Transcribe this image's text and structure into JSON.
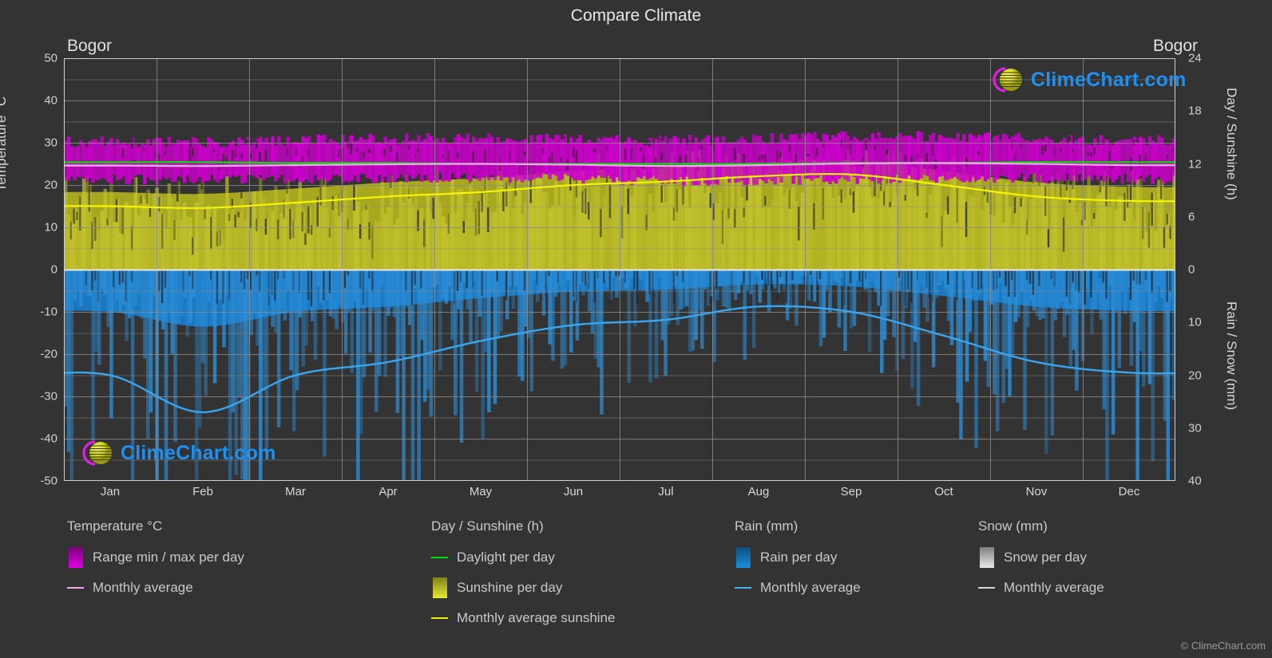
{
  "header": {
    "title": "Compare Climate",
    "location_left": "Bogor",
    "location_right": "Bogor"
  },
  "watermark": {
    "text": "ClimeChart.com",
    "copyright": "© ClimeChart.com"
  },
  "axes": {
    "left_label": "Temperature °C",
    "right_label_top": "Day / Sunshine (h)",
    "right_label_bottom": "Rain / Snow (mm)",
    "left_ticks": [
      "50",
      "40",
      "30",
      "20",
      "10",
      "0",
      "-10",
      "-20",
      "-30",
      "-40",
      "-50"
    ],
    "right_ticks_top": [
      "24",
      "18",
      "12",
      "6",
      "0"
    ],
    "right_ticks_bottom": [
      "10",
      "20",
      "30",
      "40"
    ],
    "x_ticks": [
      "Jan",
      "Feb",
      "Mar",
      "Apr",
      "May",
      "Jun",
      "Jul",
      "Aug",
      "Sep",
      "Oct",
      "Nov",
      "Dec"
    ]
  },
  "legend": {
    "groups": [
      {
        "title": "Temperature °C",
        "items": [
          {
            "label": "Range min / max per day",
            "marker": "box",
            "color": "#e000e0"
          },
          {
            "label": "Monthly average",
            "marker": "line",
            "color": "#f0a8e8"
          }
        ]
      },
      {
        "title": "Day / Sunshine (h)",
        "items": [
          {
            "label": "Daylight per day",
            "marker": "line",
            "color": "#00e000"
          },
          {
            "label": "Sunshine per day",
            "marker": "box",
            "color": "#e8e830"
          },
          {
            "label": "Monthly average sunshine",
            "marker": "line",
            "color": "#f0f000"
          }
        ]
      },
      {
        "title": "Rain (mm)",
        "items": [
          {
            "label": "Rain per day",
            "marker": "box",
            "color": "#1a8fe0"
          },
          {
            "label": "Monthly average",
            "marker": "line",
            "color": "#4ab0f0"
          }
        ]
      },
      {
        "title": "Snow (mm)",
        "items": [
          {
            "label": "Snow per day",
            "marker": "box",
            "color": "#e8e8e8"
          },
          {
            "label": "Monthly average",
            "marker": "line",
            "color": "#d8d8d8"
          }
        ]
      }
    ]
  },
  "colors": {
    "background": "#333333",
    "grid": "#8a8a8a",
    "axis": "#cfcfcf",
    "text": "#d8d8d8",
    "temp_range": "#cc00cc",
    "temp_avg": "#f0a8e8",
    "daylight": "#00e400",
    "sunshine_fill": "#a8a820",
    "sunshine_avg": "#f5f500",
    "rain_fill": "#1a78c0",
    "rain_avg": "#3aa5ef",
    "logo_blue": "#1f90f0",
    "logo_magenta": "#e020e0",
    "logo_yellow": "#d8d820"
  },
  "chart_data": {
    "type": "area",
    "title": "Compare Climate",
    "subtitle": "Bogor",
    "xlabel": "",
    "ylabel": "Temperature °C",
    "categories": [
      "Jan",
      "Feb",
      "Mar",
      "Apr",
      "May",
      "Jun",
      "Jul",
      "Aug",
      "Sep",
      "Oct",
      "Nov",
      "Dec"
    ],
    "axis_ranges": {
      "temperature_c": [
        -50,
        50
      ],
      "day_sunshine_h": [
        0,
        24
      ],
      "rain_snow_mm": [
        0,
        40
      ]
    },
    "grid": true,
    "legend_position": "bottom",
    "series": [
      {
        "name": "Monthly average temperature (°C)",
        "axis": "temperature_c",
        "color": "#f0a8e8",
        "values": [
          24.6,
          24.5,
          24.7,
          24.9,
          25.0,
          24.8,
          24.5,
          24.7,
          25.1,
          25.2,
          25.0,
          24.7
        ]
      },
      {
        "name": "Daily max temperature (°C)",
        "axis": "temperature_c",
        "color": "#cc00cc",
        "values": [
          30.1,
          30.0,
          30.5,
          30.8,
          31.0,
          30.7,
          30.5,
          30.9,
          31.4,
          31.3,
          30.9,
          30.4
        ]
      },
      {
        "name": "Daily min temperature (°C)",
        "axis": "temperature_c",
        "color": "#cc00cc",
        "values": [
          21.5,
          21.4,
          21.6,
          21.8,
          21.9,
          21.5,
          21.0,
          21.1,
          21.4,
          21.7,
          21.8,
          21.6
        ]
      },
      {
        "name": "Daylight per day (h)",
        "axis": "day_sunshine_h",
        "color": "#00e400",
        "values": [
          12.2,
          12.2,
          12.1,
          12.1,
          12.0,
          12.0,
          12.0,
          12.0,
          12.1,
          12.1,
          12.2,
          12.2
        ]
      },
      {
        "name": "Monthly average sunshine (h)",
        "axis": "day_sunshine_h",
        "color": "#f5f500",
        "values": [
          7.2,
          7.0,
          7.6,
          8.3,
          8.8,
          9.6,
          10.0,
          10.6,
          10.8,
          9.6,
          8.3,
          7.8
        ]
      },
      {
        "name": "Monthly average rain (mm)",
        "axis": "rain_snow_mm",
        "color": "#3aa5ef",
        "values": [
          20.0,
          27.0,
          20.0,
          17.5,
          13.5,
          10.5,
          9.5,
          7.0,
          8.0,
          12.5,
          17.5,
          19.5
        ]
      },
      {
        "name": "Monthly average snow (mm)",
        "axis": "rain_snow_mm",
        "color": "#d8d8d8",
        "values": [
          0,
          0,
          0,
          0,
          0,
          0,
          0,
          0,
          0,
          0,
          0,
          0
        ]
      }
    ]
  }
}
